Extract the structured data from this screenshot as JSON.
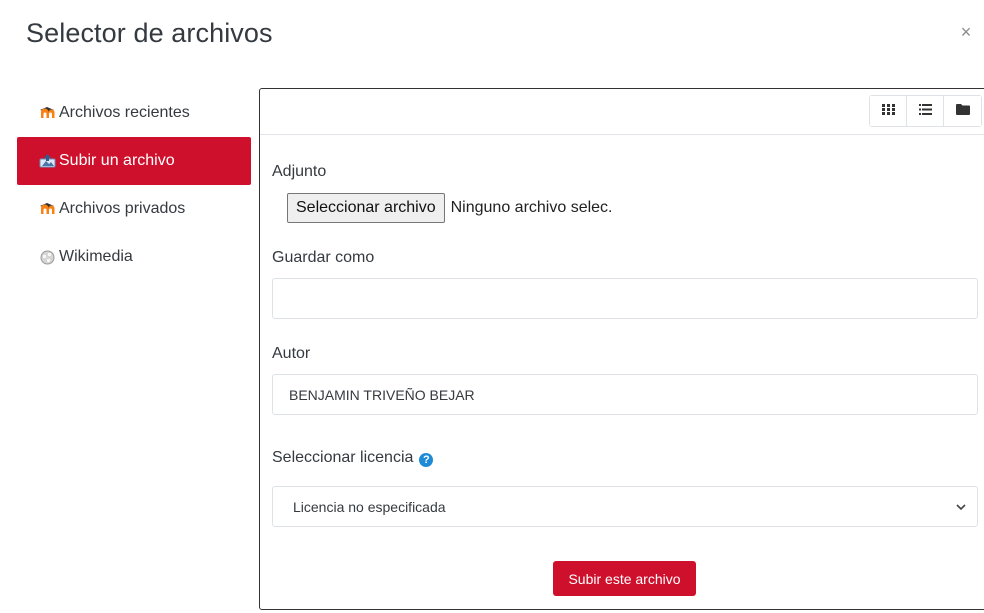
{
  "dialog": {
    "title": "Selector de archivos",
    "close_symbol": "×"
  },
  "sidebar": {
    "items": [
      {
        "label": "Archivos recientes",
        "icon": "moodle-icon",
        "active": false
      },
      {
        "label": "Subir un archivo",
        "icon": "upload-icon",
        "active": true
      },
      {
        "label": "Archivos privados",
        "icon": "moodle-icon",
        "active": false
      },
      {
        "label": "Wikimedia",
        "icon": "wikimedia-icon",
        "active": false
      }
    ]
  },
  "toolbar": {
    "views": [
      "grid-view-icon",
      "list-view-icon",
      "folder-view-icon"
    ]
  },
  "form": {
    "attachment_label": "Adjunto",
    "file_button": "Seleccionar archivo",
    "file_status": "Ninguno archivo selec.",
    "save_as_label": "Guardar como",
    "save_as_value": "",
    "author_label": "Autor",
    "author_value": "BENJAMIN TRIVEÑO BEJAR",
    "license_label": "Seleccionar licencia",
    "license_value": "Licencia no especificada",
    "submit_label": "Subir este archivo"
  },
  "colors": {
    "accent": "#cf102d",
    "help": "#1f8ad6"
  }
}
